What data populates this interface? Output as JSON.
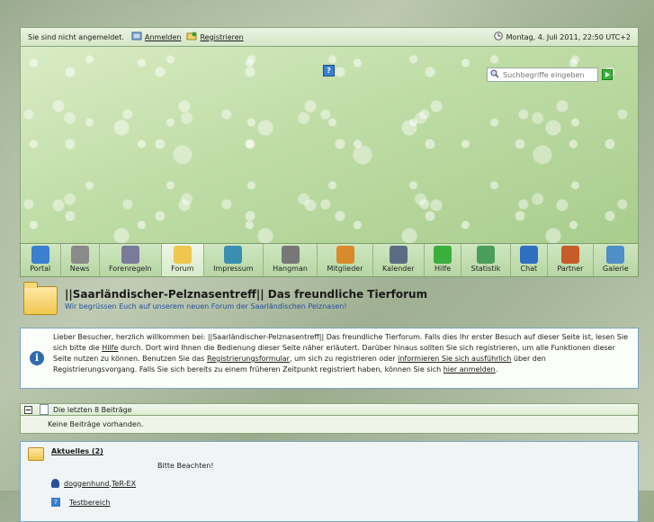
{
  "topbar": {
    "status": "Sie sind nicht angemeldet.",
    "login": "Anmelden",
    "register": "Registrieren",
    "datetime": "Montag, 4. Juli 2011, 22:50 UTC+2"
  },
  "banner": {
    "help_badge": "?",
    "search_placeholder": "Suchbegriffe eingeben"
  },
  "nav": [
    {
      "label": "Portal",
      "icon": "portal-icon",
      "color": "#3a7fd0"
    },
    {
      "label": "News",
      "icon": "news-icon",
      "color": "#8a8a8a"
    },
    {
      "label": "Forenregeln",
      "icon": "rules-icon",
      "color": "#7a7a9a"
    },
    {
      "label": "Forum",
      "icon": "forum-icon",
      "color": "#f0c64e"
    },
    {
      "label": "Impressum",
      "icon": "impressum-icon",
      "color": "#3a8fb0"
    },
    {
      "label": "Hangman",
      "icon": "hangman-icon",
      "color": "#777777"
    },
    {
      "label": "Mitglieder",
      "icon": "members-icon",
      "color": "#d98b2b"
    },
    {
      "label": "Kalender",
      "icon": "calendar-icon",
      "color": "#5b6d85"
    },
    {
      "label": "Hilfe",
      "icon": "help-icon",
      "color": "#3cae3c"
    },
    {
      "label": "Statistik",
      "icon": "statistics-icon",
      "color": "#4a9e5a"
    },
    {
      "label": "Chat",
      "icon": "chat-icon",
      "color": "#2f6fc0"
    },
    {
      "label": "Partner",
      "icon": "partner-icon",
      "color": "#c75b2a"
    },
    {
      "label": "Galerie",
      "icon": "gallery-icon",
      "color": "#4f8fc8"
    }
  ],
  "nav_active": "Forum",
  "page": {
    "title": "||Saarländischer-Pelznasentreff|| Das freundliche Tierforum",
    "subtitle": "Wir begrüssen Euch auf unserem neuen Forum der Saarländischen Pelznasen!"
  },
  "info": {
    "p1": "Lieber Besucher, herzlich willkommen bei: ||Saarländischer-Pelznasentreff|| Das freundliche Tierforum. Falls dies Ihr erster Besuch auf dieser Seite ist, lesen Sie sich bitte die ",
    "help_link": "Hilfe",
    "p2": " durch. Dort wird Ihnen die Bedienung dieser Seite näher erläutert. Darüber hinaus sollten Sie sich registrieren, um alle Funktionen dieser Seite nutzen zu können. Benutzen Sie das ",
    "reg_form_link": "Registrierungsformular",
    "p3": ", um sich zu registrieren oder ",
    "more_link": "informieren Sie sich ausführlich",
    "p4": " über den Registrierungsvorgang. Falls Sie sich bereits zu einem früheren Zeitpunkt registriert haben, können Sie sich ",
    "login_link": "hier anmelden",
    "p5": "."
  },
  "recent": {
    "title": "Die letzten 8 Beiträge",
    "empty": "Keine Beiträge vorhanden."
  },
  "board": {
    "title": "Aktuelles (2)",
    "description": "Bitte Beachten!",
    "mod1": "doggenhund",
    "sep": ", ",
    "mod2": "TeR-EX",
    "subforum": "Testbereich"
  }
}
